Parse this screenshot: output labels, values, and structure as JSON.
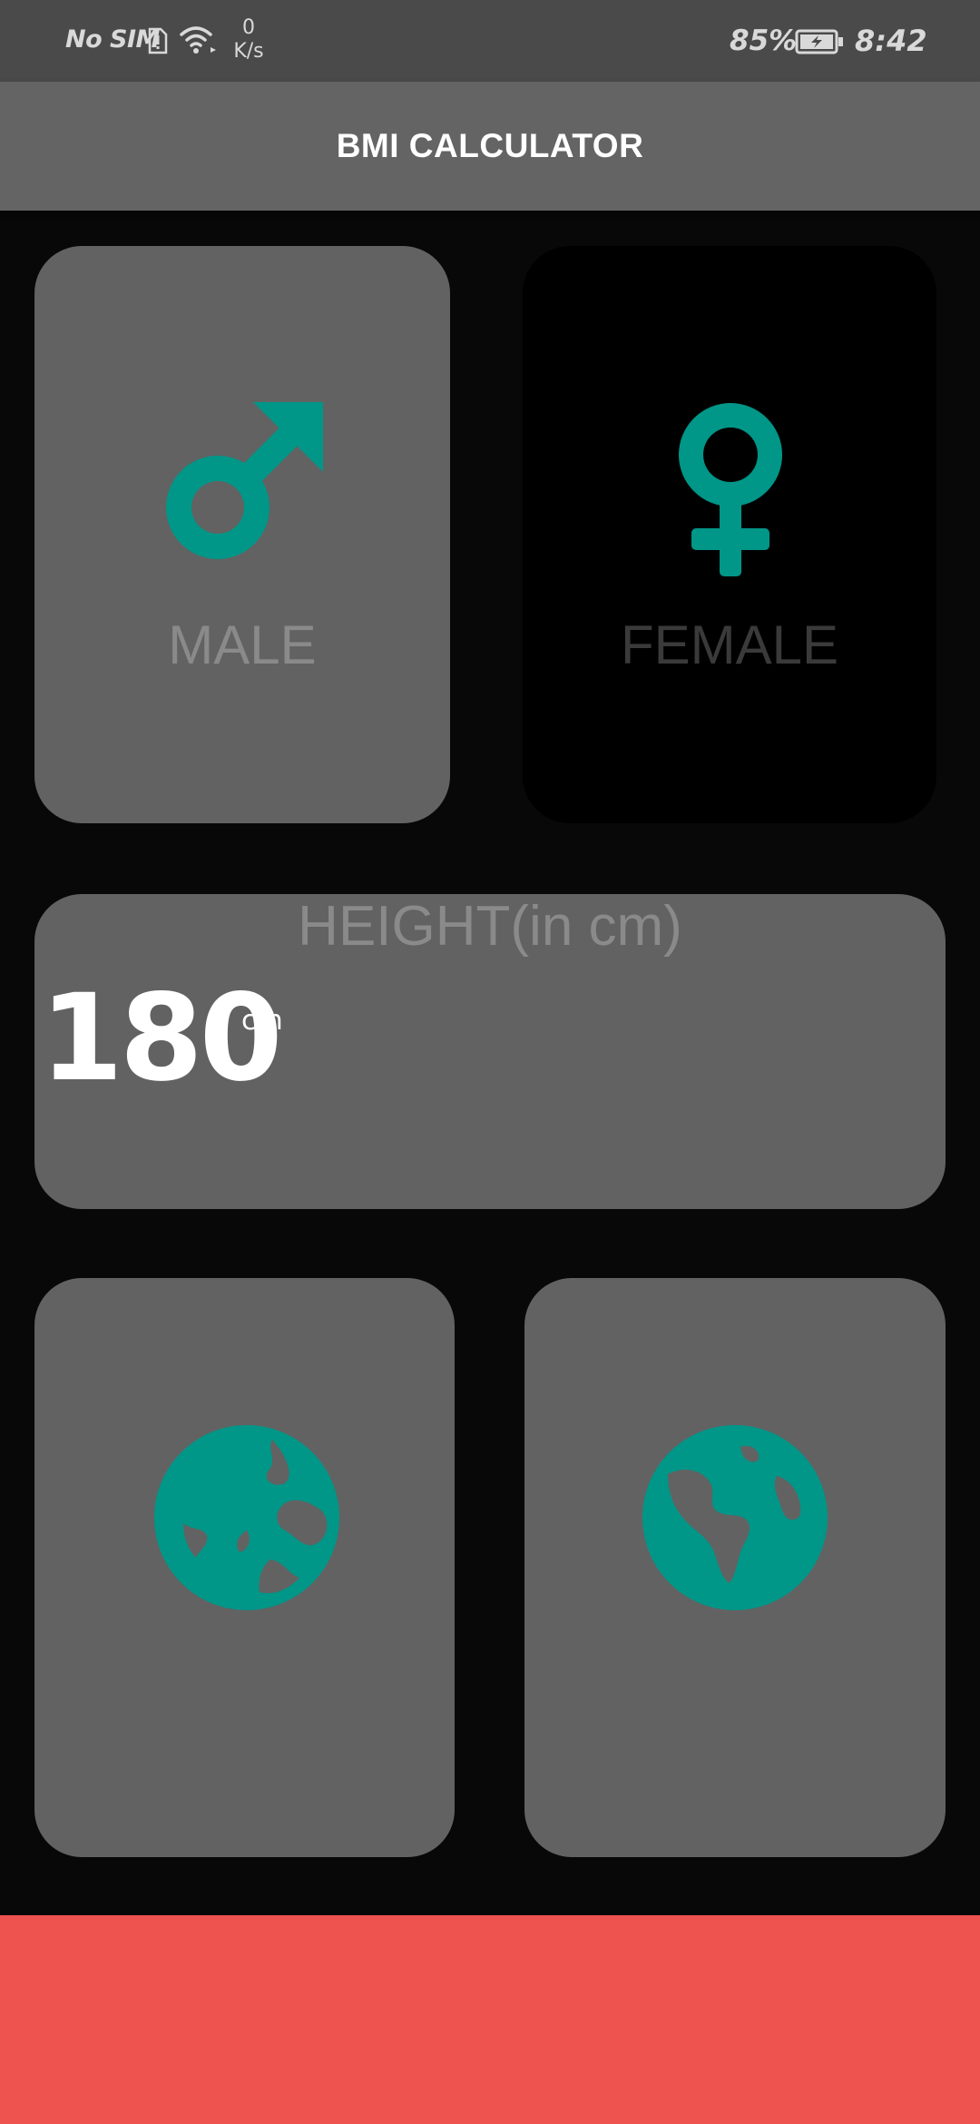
{
  "status_bar": {
    "carrier": "No SIM",
    "speed_value": "0",
    "speed_unit": "K/s",
    "battery": "85%",
    "time": "8:42"
  },
  "app_bar": {
    "title": "BMI CALCULATOR"
  },
  "gender": {
    "male_label": "MALE",
    "female_label": "FEMALE",
    "selected": "female"
  },
  "height": {
    "label": "HEIGHT(in cm)",
    "value": "180",
    "unit": "cm"
  },
  "weight_card": {
    "icon": "globe-icon"
  },
  "age_card": {
    "icon": "globe-icon"
  },
  "colors": {
    "accent": "#009688",
    "card": "#626262",
    "selected_card": "#000000",
    "background": "#080808",
    "bottom_button": "#ef5350"
  }
}
